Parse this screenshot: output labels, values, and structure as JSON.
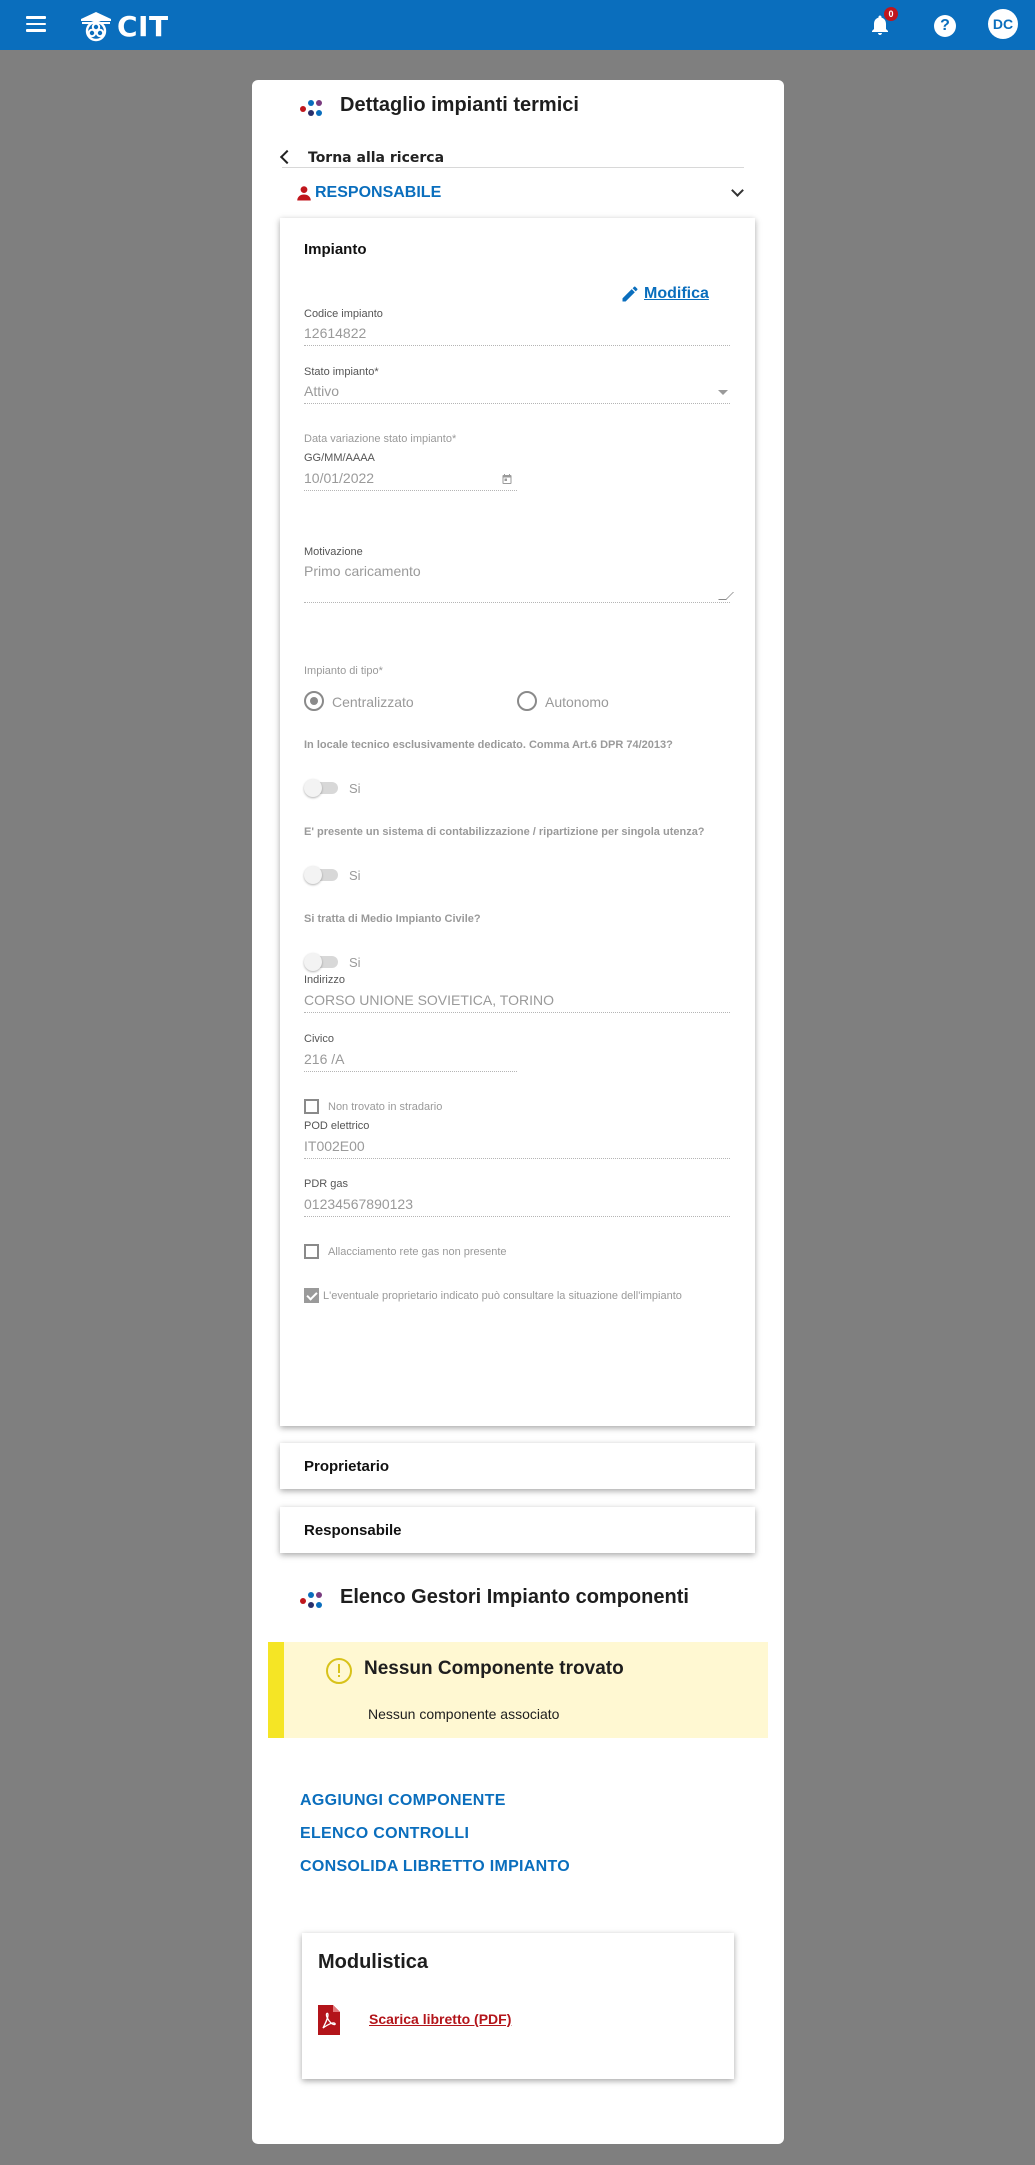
{
  "topbar": {
    "app_name": "CIT",
    "notification_count": "0",
    "help_label": "?",
    "user_initials": "DC",
    "color": "#0a6ebd"
  },
  "page": {
    "title": "Dettaglio impianti termici",
    "back_label": "Torna alla ricerca",
    "responsabile_header": "RESPONSABILE"
  },
  "impianto": {
    "title": "Impianto",
    "edit_label": "Modifica",
    "codice": {
      "label": "Codice impianto",
      "value": "12614822"
    },
    "stato": {
      "label": "Stato impianto*",
      "value": "Attivo"
    },
    "data_variazione": {
      "label": "Data variazione stato impianto*",
      "format": "GG/MM/AAAA",
      "value": "10/01/2022"
    },
    "motivazione": {
      "label": "Motivazione",
      "value": "Primo caricamento"
    },
    "tipo": {
      "label": "Impianto di tipo*",
      "options": [
        "Centralizzato",
        "Autonomo"
      ],
      "selected": "Centralizzato"
    },
    "locale_tecnico": {
      "question": "In locale tecnico esclusivamente dedicato. Comma Art.6 DPR 74/2013?",
      "toggle_label": "Si"
    },
    "contabilizzazione": {
      "question": "E' presente un sistema di contabilizzazione / ripartizione per singola utenza?",
      "toggle_label": "Si"
    },
    "medio_impianto": {
      "question": "Si tratta di Medio Impianto Civile?",
      "toggle_label": "Si"
    },
    "indirizzo": {
      "label": "Indirizzo",
      "value": "CORSO UNIONE SOVIETICA, TORINO"
    },
    "civico": {
      "label": "Civico",
      "value": "216 /A"
    },
    "non_trovato": {
      "label": "Non trovato in stradario",
      "checked": false
    },
    "pod": {
      "label": "POD elettrico",
      "value": "IT002E00"
    },
    "pdr": {
      "label": "PDR gas",
      "value": "01234567890123"
    },
    "allacciamento": {
      "label": "Allacciamento rete gas non presente",
      "checked": false
    },
    "proprietario_consulta": {
      "label": "L'eventuale proprietario indicato può consultare la situazione dell'impianto",
      "checked": true
    }
  },
  "sections": {
    "proprietario": "Proprietario",
    "responsabile": "Responsabile"
  },
  "gestori": {
    "title": "Elenco Gestori Impianto componenti",
    "alert_title": "Nessun Componente trovato",
    "alert_message": "Nessun componente associato"
  },
  "actions": {
    "aggiungi": "AGGIUNGI COMPONENTE",
    "controlli": "ELENCO CONTROLLI",
    "consolida": "CONSOLIDA LIBRETTO IMPIANTO"
  },
  "modulistica": {
    "title": "Modulistica",
    "pdf_link": "Scarica libretto (PDF)"
  }
}
